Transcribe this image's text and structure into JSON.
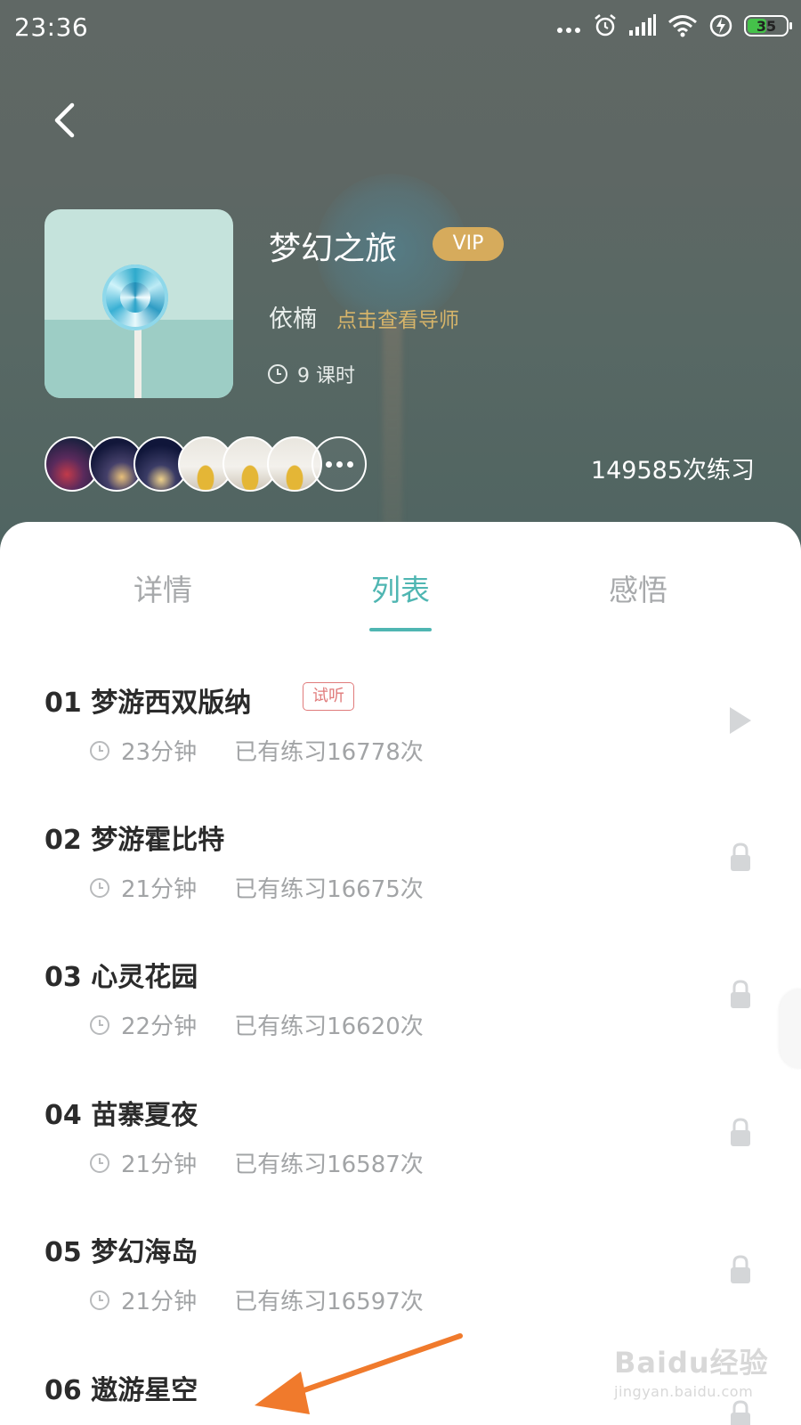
{
  "status_bar": {
    "time": "23:36",
    "battery": "35"
  },
  "course": {
    "title": "梦幻之旅",
    "badge": "VIP",
    "teacher": "依楠",
    "teacher_link": "点击查看导师",
    "lessons": "9 课时",
    "practice_count": "149585次练习"
  },
  "tabs": [
    {
      "label": "详情"
    },
    {
      "label": "列表"
    },
    {
      "label": "感悟"
    }
  ],
  "active_tab": "列表",
  "tracks": [
    {
      "title": "01 梦游西双版纳",
      "badge": "试听",
      "duration": "23分钟",
      "plays": "已有练习16778次",
      "status": "play-icon"
    },
    {
      "title": "02 梦游霍比特",
      "duration": "21分钟",
      "plays": "已有练习16675次",
      "status": "lock-icon"
    },
    {
      "title": "03 心灵花园",
      "duration": "22分钟",
      "plays": "已有练习16620次",
      "status": "lock-icon"
    },
    {
      "title": "04 苗寨夏夜",
      "duration": "21分钟",
      "plays": "已有练习16587次",
      "status": "lock-icon"
    },
    {
      "title": "05 梦幻海岛",
      "duration": "21分钟",
      "plays": "已有练习16597次",
      "status": "lock-icon"
    },
    {
      "title": "06 遨游星空",
      "status": "lock-icon"
    }
  ],
  "watermark": {
    "main": "Baidu经验",
    "sub": "jingyan.baidu.com"
  },
  "colors": {
    "accent": "#4fb6b2",
    "vip": "#d6ab5c",
    "trial": "#e07b7b",
    "arrow": "#f07a2c"
  }
}
